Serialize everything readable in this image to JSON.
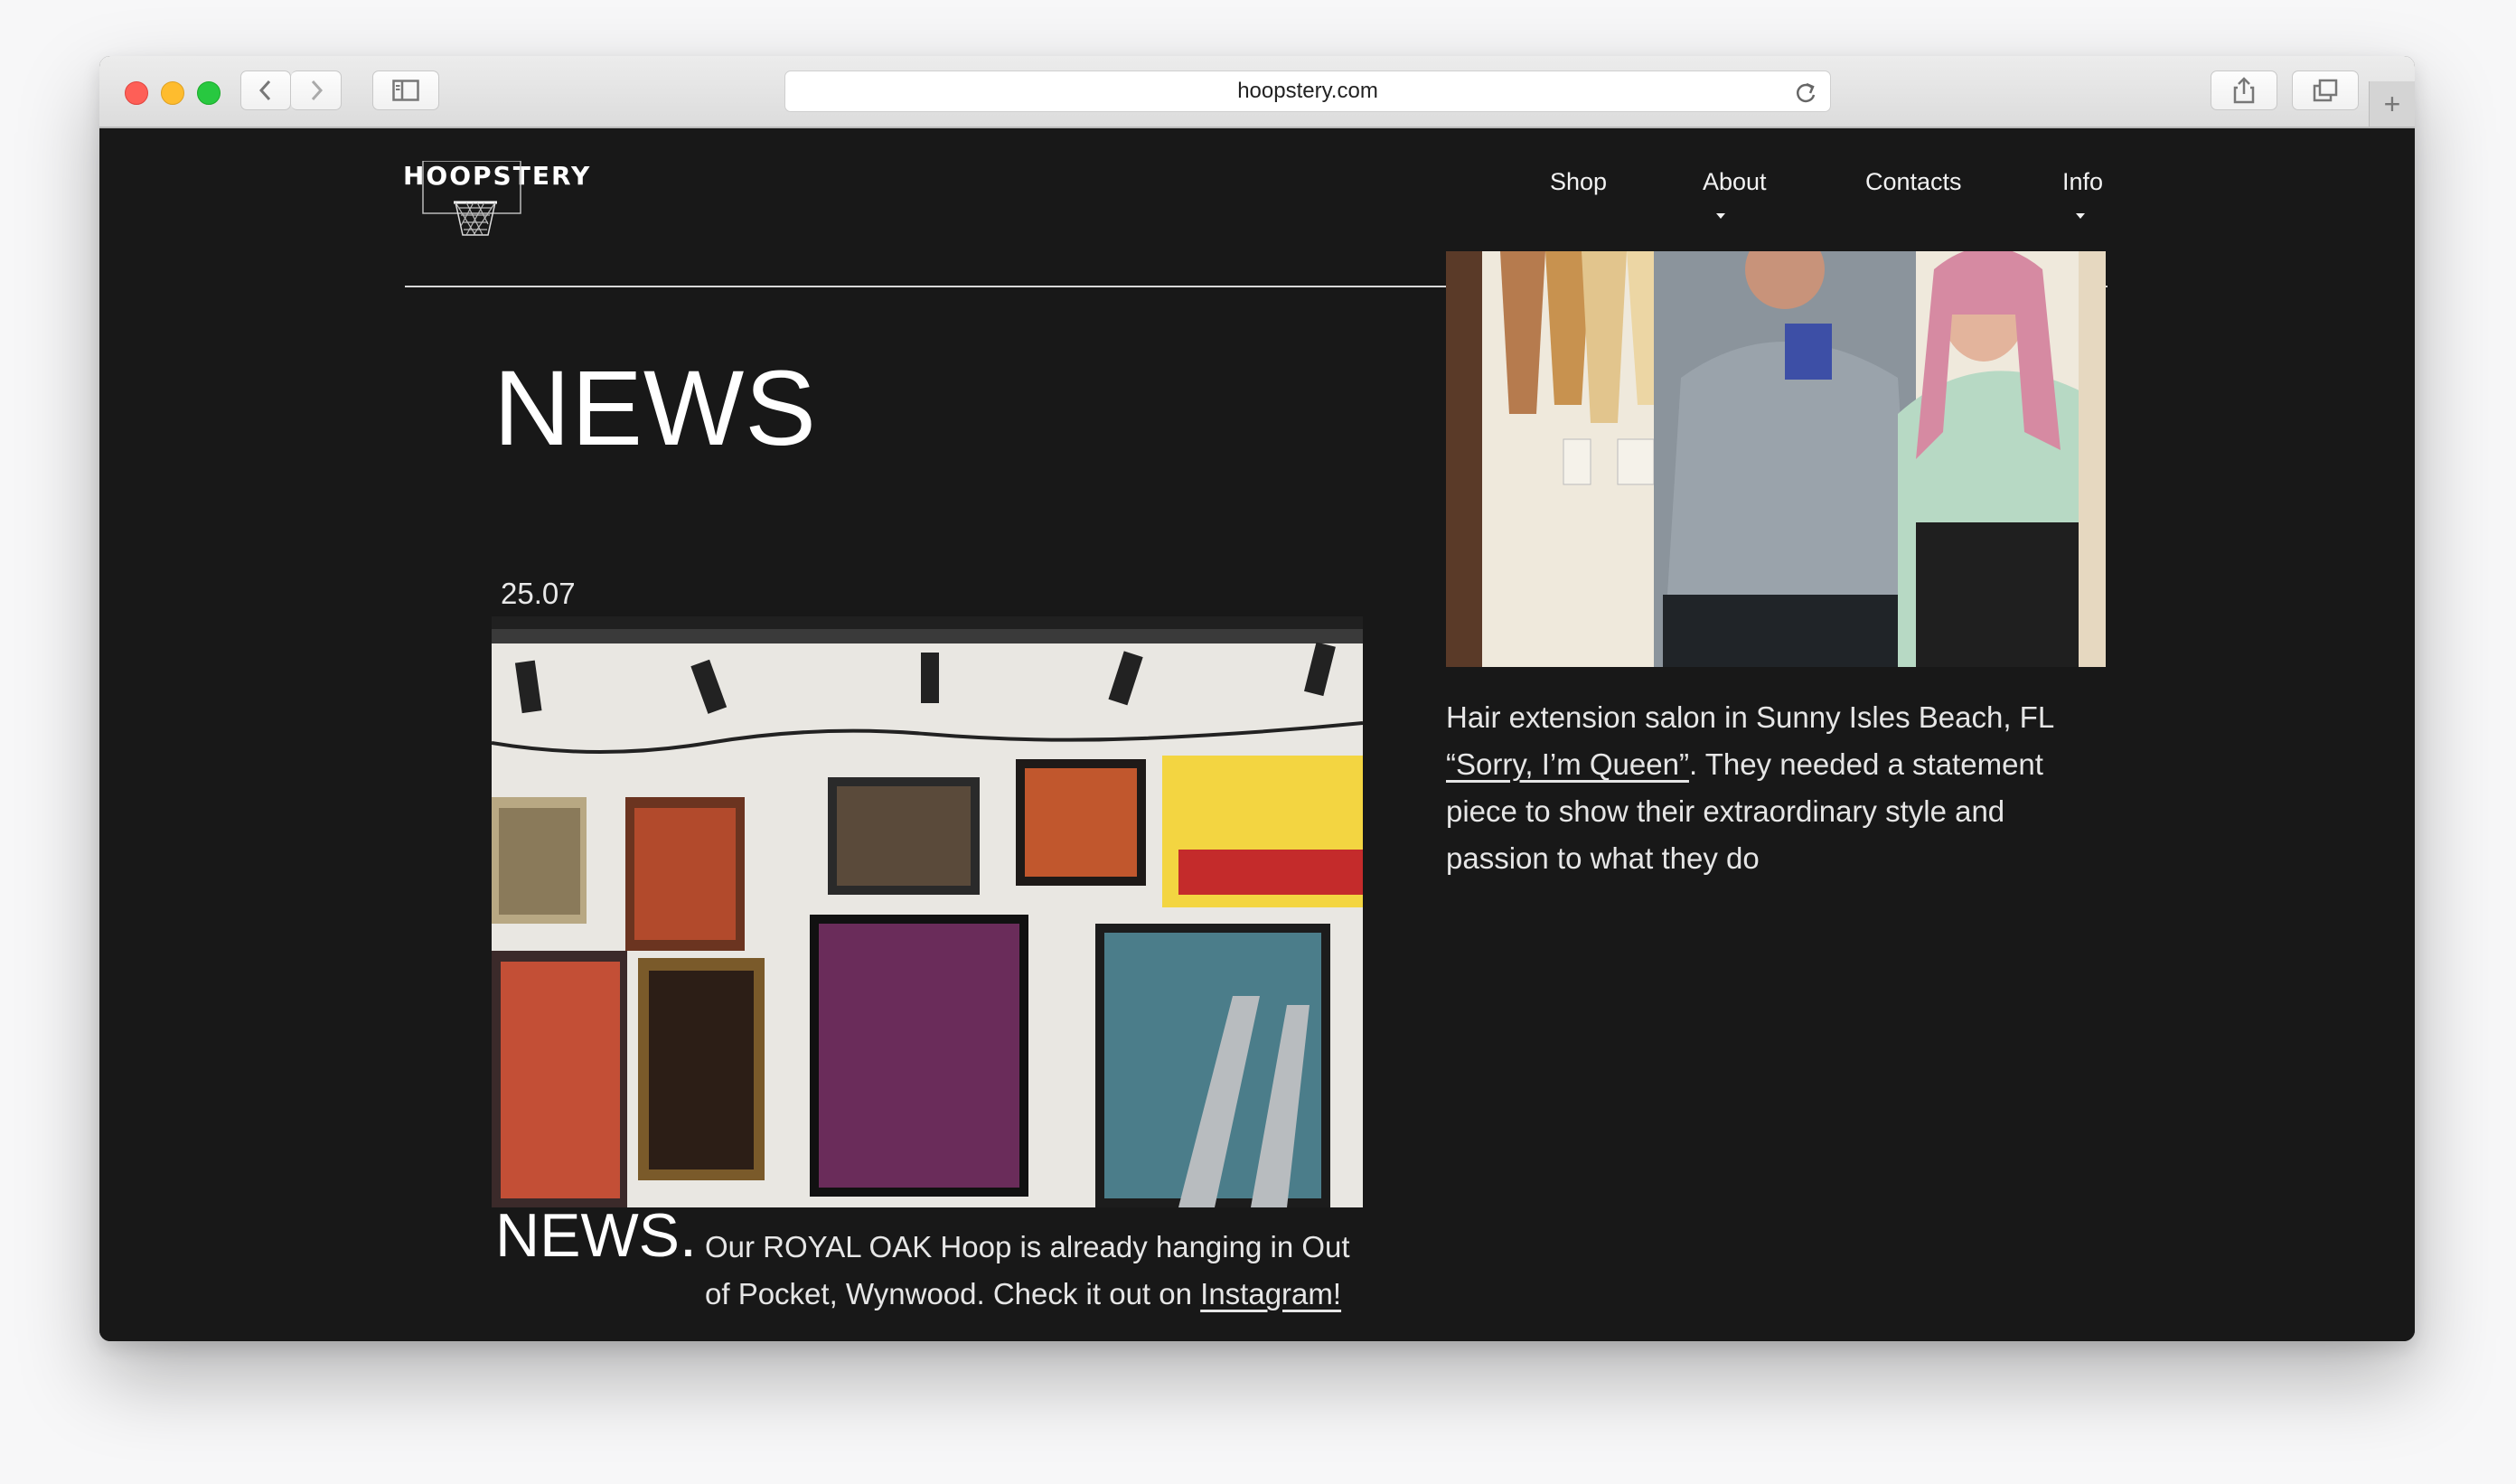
{
  "browser": {
    "url": "hoopstery.com"
  },
  "site": {
    "logo_text": "HOOPSTERY",
    "nav": [
      {
        "label": "Shop",
        "has_dropdown": false
      },
      {
        "label": "About",
        "has_dropdown": true
      },
      {
        "label": "Contacts",
        "has_dropdown": false
      },
      {
        "label": "Info",
        "has_dropdown": true
      }
    ]
  },
  "main": {
    "title": "NEWS",
    "post": {
      "date": "25.07",
      "label": "NEWS.",
      "text_before_link": "Our ROYAL OAK Hoop is already hanging in Out of Pocket, Wynwood. Check it out on ",
      "link_text": "Instagram!"
    },
    "side": {
      "line1": "Hair extension salon in Sunny Isles Beach, FL",
      "link_text": "“Sorry, I’m Queen”",
      "text_after_link": ". They needed a statement piece to show their extraordinary style and passion to what they do"
    }
  },
  "colors": {
    "page_background": "#181818",
    "text": "#e6e6e6",
    "accent_red": "#fe5f57",
    "accent_yellow": "#febc2e",
    "accent_green": "#28c840"
  }
}
